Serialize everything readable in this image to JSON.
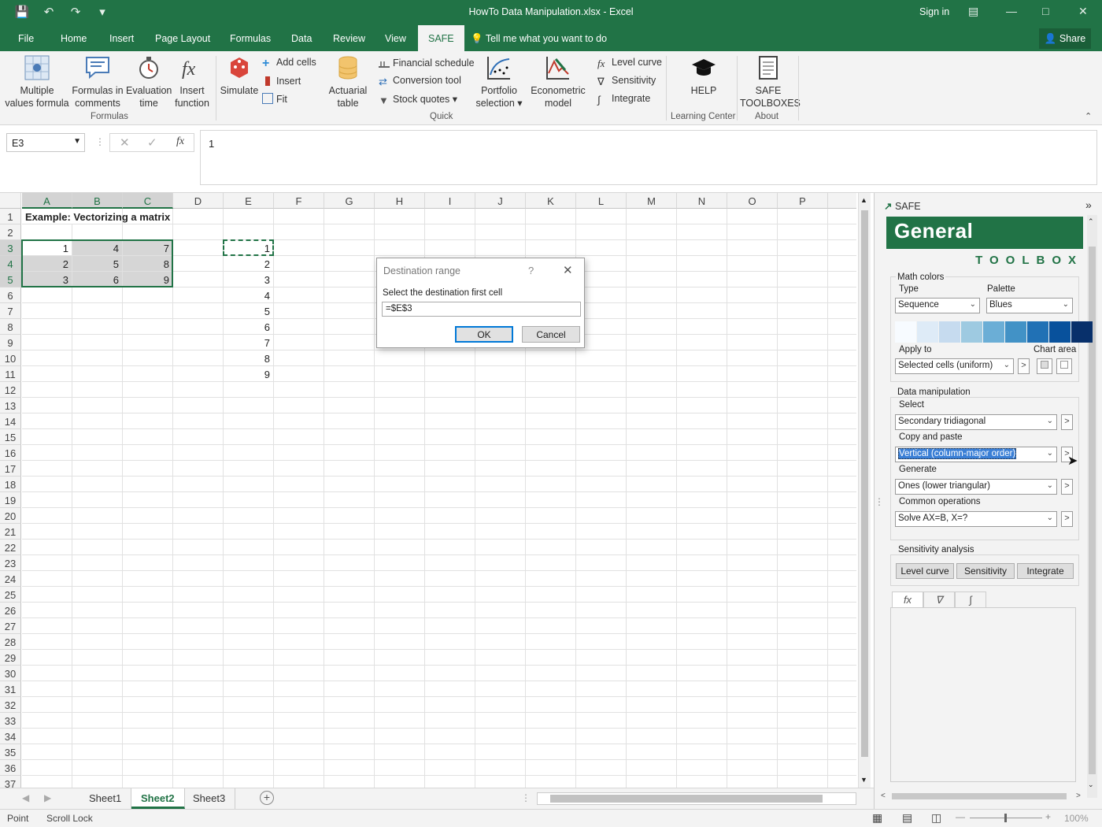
{
  "window": {
    "title": "HowTo Data Manipulation.xlsx - Excel",
    "sign_in": "Sign in"
  },
  "menu": {
    "tabs": [
      "File",
      "Home",
      "Insert",
      "Page Layout",
      "Formulas",
      "Data",
      "Review",
      "View",
      "SAFE"
    ],
    "active_tab": "SAFE",
    "tell_me": "Tell me what you want to do",
    "share": "Share"
  },
  "ribbon": {
    "formulas_group": {
      "label": "Formulas",
      "multiple_values": "Multiple values formula",
      "formulas_in_comments": "Formulas in comments",
      "evaluation_time": "Evaluation time",
      "insert_function": "Insert function"
    },
    "quick_group": {
      "label": "Quick",
      "simulate": "Simulate",
      "add_cells": "Add cells",
      "insert": "Insert",
      "fit": "Fit",
      "actuarial_table": "Actuarial table",
      "financial_schedule": "Financial schedule",
      "conversion_tool": "Conversion tool",
      "stock_quotes": "Stock quotes",
      "portfolio_selection": "Portfolio selection",
      "econometric_model": "Econometric model",
      "level_curve": "Level curve",
      "sensitivity": "Sensitivity",
      "integrate": "Integrate"
    },
    "learning_group": {
      "label": "Learning Center",
      "help": "HELP"
    },
    "about_group": {
      "label": "About",
      "safe_toolboxes": "SAFE TOOLBOXES"
    }
  },
  "formula_bar": {
    "name_box": "E3",
    "value": "1"
  },
  "sheet": {
    "columns": [
      "A",
      "B",
      "C",
      "D",
      "E",
      "F",
      "G",
      "H",
      "I",
      "J",
      "K",
      "L",
      "M",
      "N",
      "O",
      "P"
    ],
    "row_count": 37,
    "a1_text": "Example: Vectorizing a matrix",
    "matrix": [
      [
        1,
        4,
        7
      ],
      [
        2,
        5,
        8
      ],
      [
        3,
        6,
        9
      ]
    ],
    "vector": [
      1,
      2,
      3,
      4,
      5,
      6,
      7,
      8,
      9
    ]
  },
  "sheet_tabs": [
    "Sheet1",
    "Sheet2",
    "Sheet3"
  ],
  "active_sheet": "Sheet2",
  "status": {
    "mode": "Point",
    "scroll_lock": "Scroll Lock",
    "zoom": "100%"
  },
  "dialog": {
    "title": "Destination range",
    "prompt": "Select the destination first cell",
    "value": "=$E$3",
    "ok": "OK",
    "cancel": "Cancel"
  },
  "panel": {
    "header": "SAFE",
    "title": "General",
    "subtitle": "TOOLBOX",
    "math_colors": {
      "label": "Math colors",
      "type_label": "Type",
      "type_value": "Sequence",
      "palette_label": "Palette",
      "palette_value": "Blues",
      "swatches": [
        "#f7fbff",
        "#deebf7",
        "#c6dbef",
        "#9ecae1",
        "#6baed6",
        "#4292c6",
        "#2171b5",
        "#08519c",
        "#08306b"
      ],
      "apply_to_label": "Apply to",
      "apply_to_value": "Selected cells (uniform)",
      "chart_area_label": "Chart area"
    },
    "data_manipulation": {
      "label": "Data manipulation",
      "select_label": "Select",
      "select_value": "Secondary tridiagonal",
      "copy_label": "Copy and paste",
      "copy_value": "Vertical (column-major order)",
      "generate_label": "Generate",
      "generate_value": "Ones (lower triangular)",
      "common_label": "Common operations",
      "common_value": "Solve AX=B, X=?"
    },
    "sensitivity": {
      "label": "Sensitivity analysis",
      "level_curve": "Level curve",
      "sensitivity": "Sensitivity",
      "integrate": "Integrate"
    }
  },
  "colors": {
    "excel_green": "#217346",
    "selection_fill": "#d6d6d6",
    "dialog_focus": "#0078d7"
  }
}
